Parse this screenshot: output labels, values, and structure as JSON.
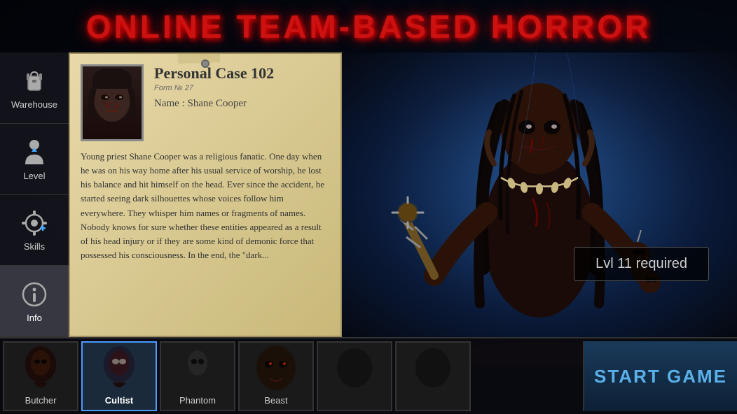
{
  "title": "ONLINE TEAM-BASED HORROR",
  "sidebar": {
    "items": [
      {
        "id": "warehouse",
        "label": "Warehouse",
        "icon": "backpack"
      },
      {
        "id": "level",
        "label": "Level",
        "icon": "person"
      },
      {
        "id": "skills",
        "label": "Skills",
        "icon": "gear-plus"
      },
      {
        "id": "info",
        "label": "Info",
        "icon": "info",
        "active": true
      }
    ]
  },
  "case": {
    "title": "Personal Case 102",
    "form_label": "Form № 27",
    "name_label": "Name :",
    "name_value": "Shane Cooper",
    "body": "Young priest Shane Cooper was a religious fanatic. One day when he was on his way home after his usual service of worship, he lost his balance and hit himself on the head. Ever since the accident, he started seeing dark silhouettes whose voices follow him everywhere. They whisper him names or fragments of names. Nobody knows for sure whether these entities appeared as a result of his head injury or if they are some kind of demonic force that possessed his consciousness. In the end, the \"dark..."
  },
  "monster": {
    "lvl_required": "Lvl 11 required"
  },
  "characters": [
    {
      "id": "butcher",
      "label": "Butcher",
      "active": false
    },
    {
      "id": "cultist",
      "label": "Cultist",
      "active": true
    },
    {
      "id": "phantom",
      "label": "Phantom",
      "active": false
    },
    {
      "id": "beast",
      "label": "Beast",
      "active": false
    },
    {
      "id": "slot5",
      "label": "",
      "active": false
    },
    {
      "id": "slot6",
      "label": "",
      "active": false
    }
  ],
  "start_button": "START GAME",
  "colors": {
    "title_red": "#cc1111",
    "accent_blue": "#5ab0e8",
    "active_border": "#4a9aff"
  }
}
